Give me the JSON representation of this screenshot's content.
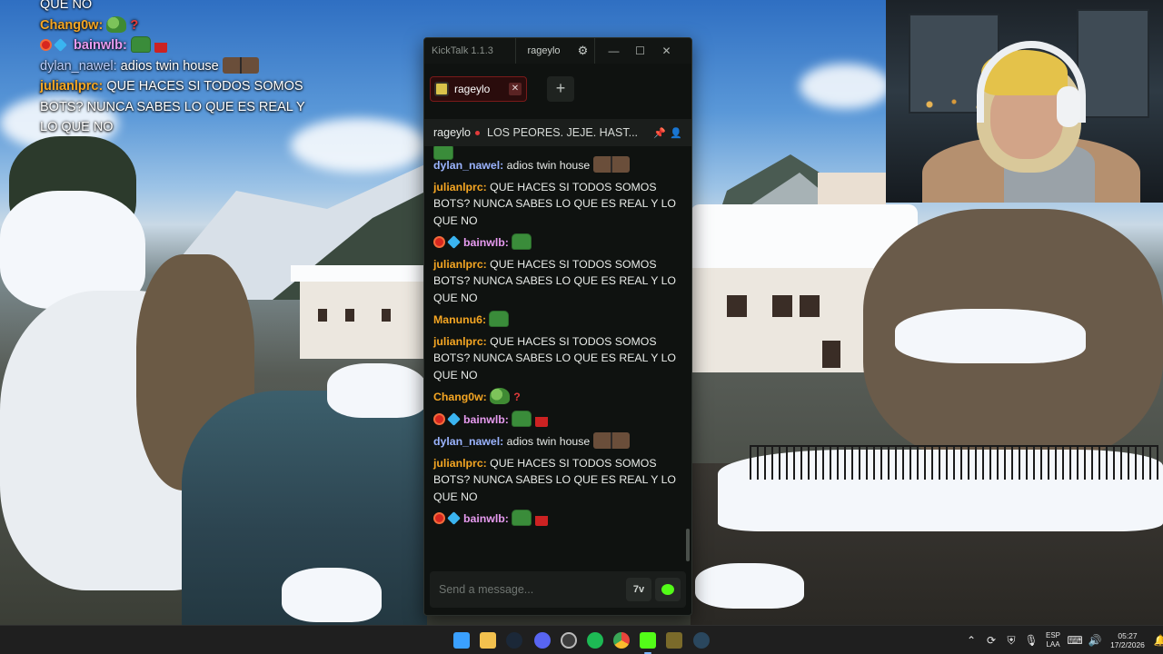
{
  "overlay_chat": {
    "lines": [
      {
        "name": "",
        "text": "QUE NO",
        "color": "#ffffff"
      },
      {
        "name": "Chang0w:",
        "text": "",
        "color": "#f5a623"
      },
      {
        "name": "bainwlb:",
        "text": "",
        "color": "#e79bf0"
      },
      {
        "name": "dylan_nawel:",
        "text": " adios twin house",
        "color": "#bcd0ff"
      },
      {
        "name": "julianlprc:",
        "text": " QUE HACES SI TODOS SOMOS BOTS? NUNCA SABES LO QUE ES REAL Y LO QUE NO",
        "color": "#f5a623"
      }
    ]
  },
  "kicktalk": {
    "app_title": "KickTalk 1.1.3",
    "username": "rageylo",
    "settings_icon": "gear-icon",
    "window_controls": {
      "minimize": "—",
      "maximize": "☐",
      "close": "✕"
    },
    "tab": {
      "label": "rageylo",
      "close": "✕",
      "accent": "#7a1a1a"
    },
    "add_tab": "+",
    "chat_header": {
      "channel": "rageylo",
      "title": "LOS PEORES. JEJE. HAST..."
    },
    "messages": [
      {
        "name": "dylan_nawel:",
        "color": "#9bb4ff",
        "text": " adios twin house",
        "emote": "duo",
        "badges": false
      },
      {
        "name": "julianlprc:",
        "color": "#f5a623",
        "text": " QUE HACES SI TODOS SOMOS BOTS? NUNCA SABES LO QUE ES REAL Y LO QUE NO",
        "emote": "",
        "badges": false
      },
      {
        "name": "bainwlb:",
        "color": "#e79bf0",
        "text": " ",
        "emote": "frog",
        "badges": true
      },
      {
        "name": "julianlprc:",
        "color": "#f5a623",
        "text": " QUE HACES SI TODOS SOMOS BOTS? NUNCA SABES LO QUE ES REAL Y LO QUE NO",
        "emote": "",
        "badges": false
      },
      {
        "name": "Manunu6:",
        "color": "#f5a623",
        "text": " ",
        "emote": "frog",
        "badges": false
      },
      {
        "name": "julianlprc:",
        "color": "#f5a623",
        "text": " QUE HACES SI TODOS SOMOS BOTS? NUNCA SABES LO QUE ES REAL Y LO QUE NO",
        "emote": "",
        "badges": false
      },
      {
        "name": "Chang0w:",
        "color": "#f5a623",
        "text": " ",
        "emote": "pepe",
        "badges": false,
        "extra": "?"
      },
      {
        "name": "bainwlb:",
        "color": "#e79bf0",
        "text": " ",
        "emote": "frog",
        "badges": true,
        "extra_bottle": true
      },
      {
        "name": "dylan_nawel:",
        "color": "#9bb4ff",
        "text": " adios twin house",
        "emote": "duo",
        "badges": false
      },
      {
        "name": "julianlprc:",
        "color": "#f5a623",
        "text": " QUE HACES SI TODOS SOMOS BOTS? NUNCA SABES LO QUE ES REAL Y LO QUE NO",
        "emote": "",
        "badges": false
      },
      {
        "name": "bainwlb:",
        "color": "#e79bf0",
        "text": " ",
        "emote": "frog",
        "badges": true,
        "extra_bottle": true
      }
    ],
    "input_placeholder": "Send a message...",
    "btn_7tv": "7v"
  },
  "taskbar": {
    "apps": [
      {
        "name": "start-icon",
        "color": "#3aa0ff"
      },
      {
        "name": "file-explorer-icon",
        "color": "#f2c14e"
      },
      {
        "name": "steam-icon",
        "color": "#1b2838"
      },
      {
        "name": "discord-icon",
        "color": "#5865f2"
      },
      {
        "name": "obs-icon",
        "color": "#3d3d3d"
      },
      {
        "name": "spotify-icon",
        "color": "#1db954"
      },
      {
        "name": "chrome-icon",
        "color": "#e8453c"
      },
      {
        "name": "kicktalk-icon",
        "color": "#53fc18"
      },
      {
        "name": "game-icon",
        "color": "#7a6a2a"
      },
      {
        "name": "steam2-icon",
        "color": "#2a475e"
      }
    ],
    "lang_top": "ESP",
    "lang_bottom": "LAA",
    "time": "05:27",
    "date": "17/2/2026"
  }
}
